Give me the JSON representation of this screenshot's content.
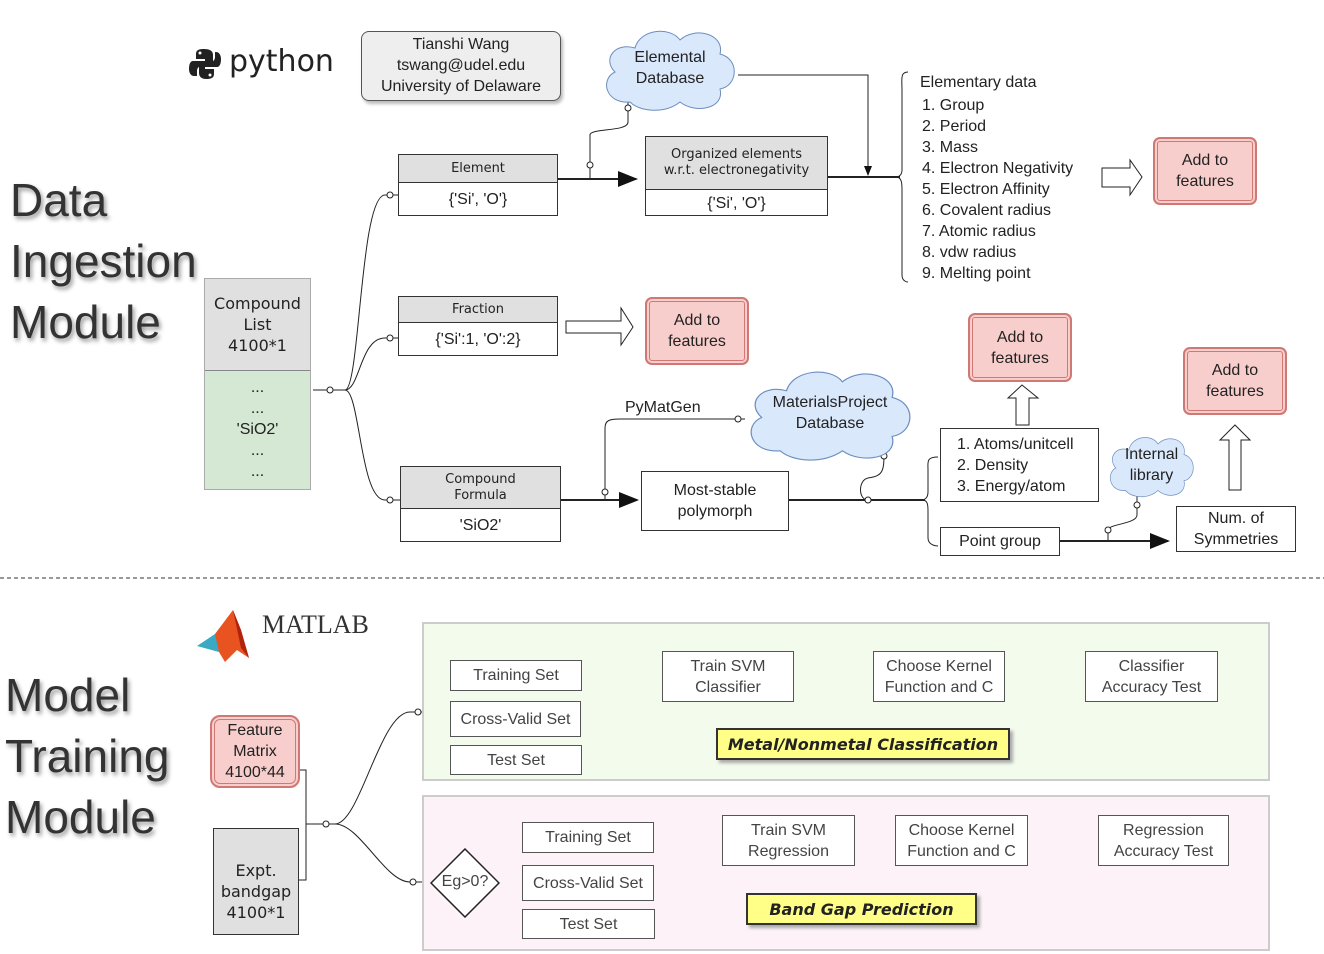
{
  "sections": {
    "ingestion": [
      "Data",
      "Ingestion",
      "Module"
    ],
    "training": [
      "Model",
      "Training",
      "Module"
    ]
  },
  "logos": {
    "python": "python",
    "matlab": "MATLAB"
  },
  "author": {
    "name": "Tianshi Wang",
    "email": "tswang@udel.edu",
    "affiliation": "University of Delaware"
  },
  "elemental_db": [
    "Elemental",
    "Database"
  ],
  "element_table": {
    "header": "Element",
    "value": "{'Si', 'O'}"
  },
  "organized_table": {
    "header": [
      "Organized elements",
      "w.r.t. electronegativity"
    ],
    "value": "{'Si', 'O'}"
  },
  "elementary_data": {
    "title": "Elementary data",
    "items": [
      "1. Group",
      "2. Period",
      "3. Mass",
      "4. Electron Negativity",
      "5. Electron Affinity",
      "6. Covalent radius",
      "7. Atomic radius",
      "8. vdw radius",
      "9. Melting point"
    ]
  },
  "add_to_features": [
    "Add to",
    "features"
  ],
  "compound_list": {
    "header": [
      "Compound",
      "List",
      "4100*1"
    ],
    "values": [
      "...",
      "...",
      "'SiO2'",
      "...",
      "..."
    ]
  },
  "fraction_table": {
    "header": "Fraction",
    "value": "{'Si':1, 'O':2}"
  },
  "formula_table": {
    "header": [
      "Compound",
      "Formula"
    ],
    "value": "'SiO2'"
  },
  "pymatgen": "PyMatGen",
  "mp_db": [
    "MaterialsProject",
    "Database"
  ],
  "most_stable": [
    "Most-stable",
    "polymorph"
  ],
  "properties": [
    "1. Atoms/unitcell",
    "2. Density",
    "3. Energy/atom"
  ],
  "internal_lib": [
    "Internal",
    "library"
  ],
  "point_group": "Point group",
  "num_sym": [
    "Num. of",
    "Symmetries"
  ],
  "feature_matrix": [
    "Feature",
    "Matrix",
    "4100*44"
  ],
  "bandgap": [
    "Expt.",
    "bandgap",
    "4100*1"
  ],
  "classification": {
    "training": "Training Set",
    "cross": "Cross-Valid Set",
    "test": "Test Set",
    "train": [
      "Train SVM",
      "Classifier"
    ],
    "kernel": [
      "Choose Kernel",
      "Function and C"
    ],
    "accuracy": [
      "Classifier",
      "Accuracy Test"
    ],
    "label": "Metal/Nonmetal Classification"
  },
  "regression": {
    "decision": "Eg>0?",
    "training": "Training Set",
    "cross": "Cross-Valid Set",
    "test": "Test Set",
    "train": [
      "Train SVM",
      "Regression"
    ],
    "kernel": [
      "Choose Kernel",
      "Function and C"
    ],
    "accuracy": [
      "Regression",
      "Accuracy Test"
    ],
    "label": "Band Gap Prediction"
  },
  "colors": {
    "add_fill": "#f8cecc",
    "cloud_fill": "#dae8fc",
    "compound_green": "#d5e8d4",
    "panel_green": "#f2fbec",
    "panel_pink": "#fdf2f8",
    "label_yellow": "#ffff88"
  }
}
